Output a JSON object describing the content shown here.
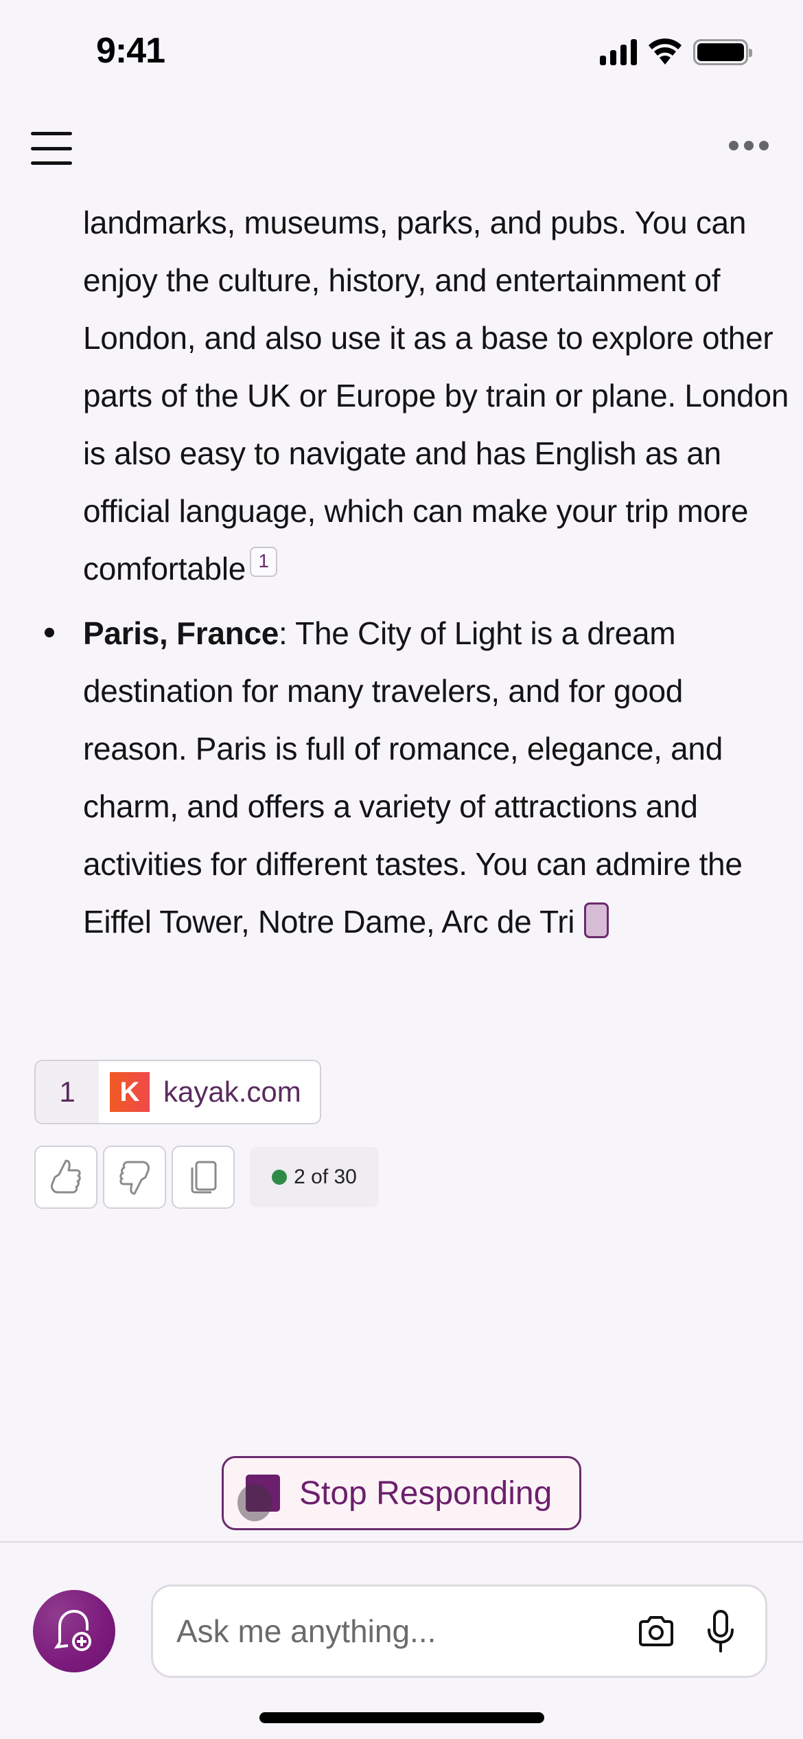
{
  "status_bar": {
    "time": "9:41",
    "icons": [
      "cellular-signal-icon",
      "wifi-icon",
      "battery-icon"
    ]
  },
  "nav": {
    "menu_icon": "hamburger-menu-icon",
    "more_icon": "more-options-icon"
  },
  "message": {
    "intro_paragraph": "landmarks, museums, parks, and pubs. You can enjoy the culture, history, and entertainment of London, and also use it as a base to explore other parts of the UK or Europe by train or plane. London is also easy to navigate and has English as an official language, which can make your trip more comfortable",
    "intro_citation": "1",
    "bullets": [
      {
        "title": "Paris, France",
        "separator": ":",
        "text": " The City of Light is a dream destination for many travelers, and for good reason. Paris is full of romance, elegance, and charm, and offers a variety of attractions and activities for different tastes. You can admire the Eiffel Tower, Notre Dame, Arc de Tri"
      }
    ]
  },
  "citations": [
    {
      "number": "1",
      "logo_letter": "K",
      "domain": "kayak.com"
    }
  ],
  "actions": {
    "like_icon": "thumbs-up-icon",
    "dislike_icon": "thumbs-down-icon",
    "copy_icon": "copy-icon",
    "counter": "2 of 30",
    "colors": {
      "counter_dot": "#2e8b47"
    }
  },
  "stop_button": {
    "label": "Stop Responding"
  },
  "composer": {
    "placeholder": "Ask me anything...",
    "value": "",
    "new_topic_icon": "new-chat-icon",
    "camera_icon": "camera-icon",
    "mic_icon": "microphone-icon"
  },
  "colors": {
    "accent": "#6c1f6c",
    "background": "#f7f5f9"
  }
}
